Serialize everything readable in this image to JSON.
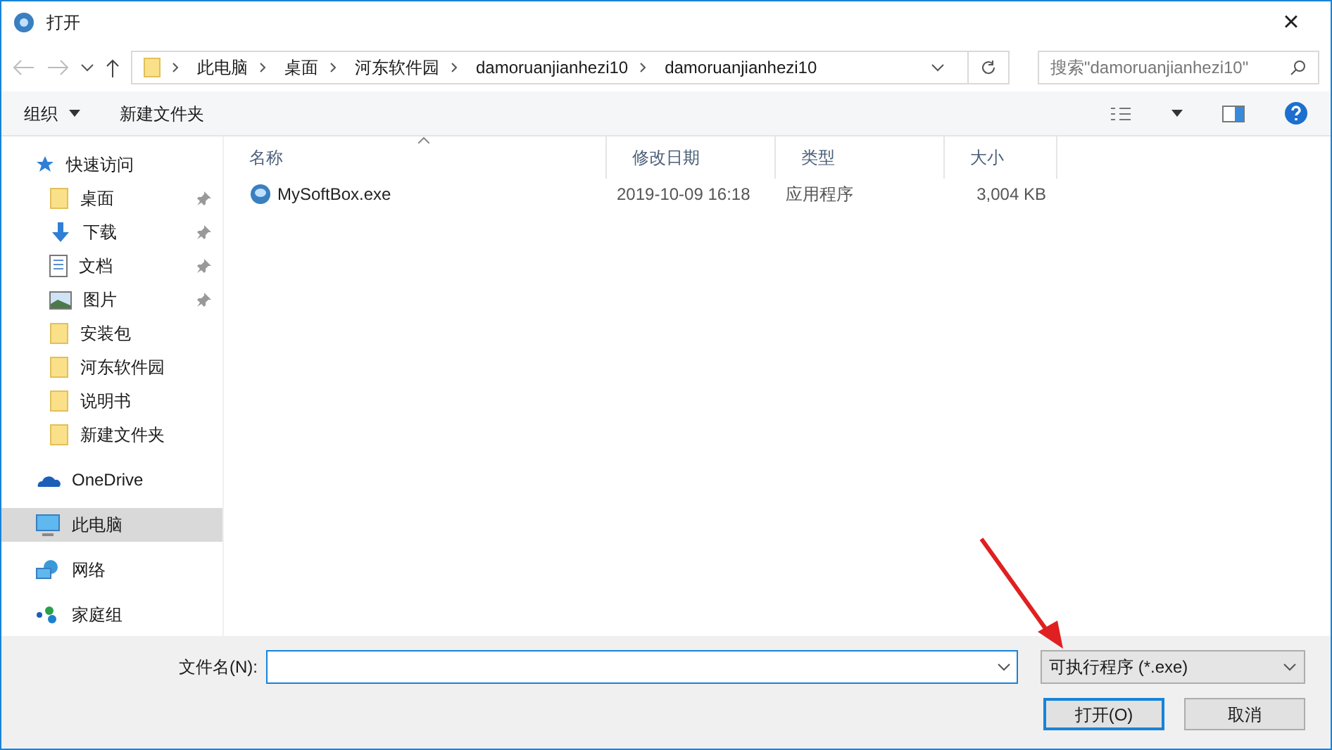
{
  "window": {
    "title": "打开",
    "close": "×"
  },
  "address": {
    "crumbs": [
      "此电脑",
      "桌面",
      "河东软件园",
      "damoruanjianhezi10",
      "damoruanjianhezi10"
    ],
    "search_placeholder": "搜索\"damoruanjianhezi10\""
  },
  "toolbar": {
    "organize": "组织",
    "new_folder": "新建文件夹"
  },
  "sidebar": {
    "items": [
      {
        "label": "快速访问",
        "kind": "star",
        "selected": false,
        "children": [
          {
            "label": "桌面",
            "kind": "folder",
            "pinned": true
          },
          {
            "label": "下载",
            "kind": "download",
            "pinned": true
          },
          {
            "label": "文档",
            "kind": "document",
            "pinned": true
          },
          {
            "label": "图片",
            "kind": "picture",
            "pinned": true
          },
          {
            "label": "安装包",
            "kind": "folder",
            "pinned": false
          },
          {
            "label": "河东软件园",
            "kind": "folder",
            "pinned": false
          },
          {
            "label": "说明书",
            "kind": "folder",
            "pinned": false
          },
          {
            "label": "新建文件夹",
            "kind": "folder",
            "pinned": false
          }
        ]
      },
      {
        "label": "OneDrive",
        "kind": "cloud",
        "selected": false
      },
      {
        "label": "此电脑",
        "kind": "computer",
        "selected": true
      },
      {
        "label": "网络",
        "kind": "network",
        "selected": false
      },
      {
        "label": "家庭组",
        "kind": "homegroup",
        "selected": false
      }
    ]
  },
  "table": {
    "columns": [
      "名称",
      "修改日期",
      "类型",
      "大小"
    ],
    "rows": [
      {
        "name": "MySoftBox.exe",
        "date": "2019-10-09 16:18",
        "type": "应用程序",
        "size": "3,004 KB",
        "selected": false
      }
    ]
  },
  "footer": {
    "filename_label": "文件名(N):",
    "filter": "可执行程序 (*.exe)",
    "open": "打开(O)",
    "cancel": "取消"
  }
}
